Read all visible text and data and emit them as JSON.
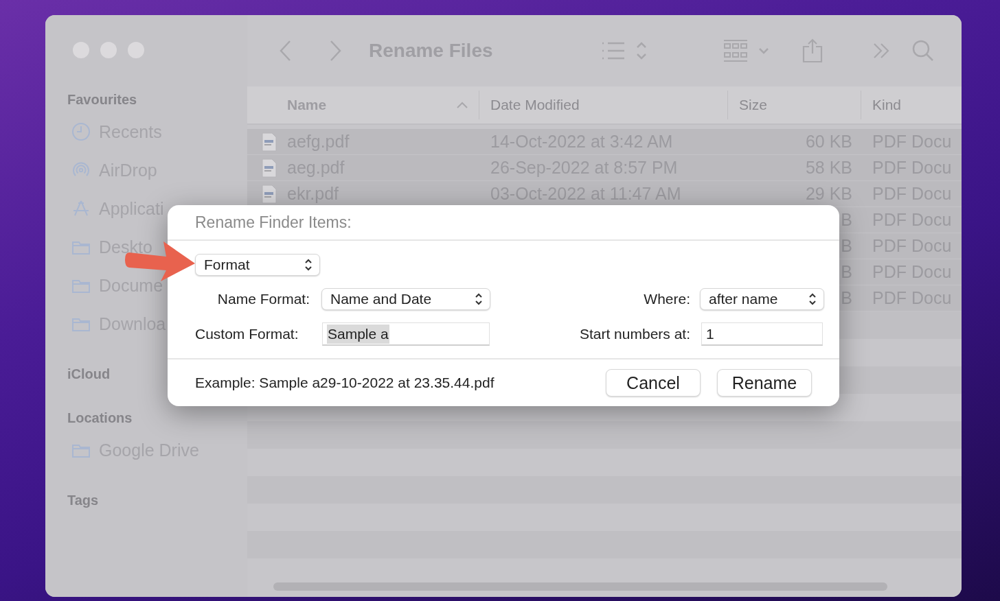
{
  "window": {
    "title": "Rename Files"
  },
  "sidebar": {
    "sections": [
      {
        "heading": "Favourites",
        "items": [
          {
            "label": "Recents",
            "kind": "clock"
          },
          {
            "label": "AirDrop",
            "kind": "airdrop"
          },
          {
            "label": "Applicati",
            "kind": "apps"
          },
          {
            "label": "Deskto",
            "kind": "folder"
          },
          {
            "label": "Docume",
            "kind": "folder"
          },
          {
            "label": "Downloa",
            "kind": "folder"
          }
        ]
      },
      {
        "heading": "iCloud"
      },
      {
        "heading": "Locations",
        "items": [
          {
            "label": "Google Drive",
            "kind": "folder"
          }
        ]
      },
      {
        "heading": "Tags"
      }
    ]
  },
  "table": {
    "columns": [
      {
        "label": "Name",
        "sorted": true
      },
      {
        "label": "Date Modified",
        "sorted": false
      },
      {
        "label": "Size",
        "sorted": false
      },
      {
        "label": "Kind",
        "sorted": false
      }
    ],
    "rows": [
      {
        "name": "aefg.pdf",
        "date": "14-Oct-2022 at 3:42 AM",
        "size": "60 KB",
        "kind": "PDF Docu",
        "selected": true
      },
      {
        "name": "aeg.pdf",
        "date": "26-Sep-2022 at 8:57 PM",
        "size": "58 KB",
        "kind": "PDF Docu",
        "selected": true
      },
      {
        "name": "ekr.pdf",
        "date": "03-Oct-2022 at 11:47 AM",
        "size": "29 KB",
        "kind": "PDF Docu",
        "selected": true
      },
      {
        "size": "B",
        "kind": "PDF Docu",
        "selected": true
      },
      {
        "size": "B",
        "kind": "PDF Docu",
        "selected": true
      },
      {
        "size": "B",
        "kind": "PDF Docu",
        "selected": true
      },
      {
        "size": "B",
        "kind": "PDF Docu",
        "selected": true
      }
    ]
  },
  "dialog": {
    "title": "Rename Finder Items:",
    "mode": "Format",
    "name_format": {
      "label": "Name Format:",
      "value": "Name and Date"
    },
    "where": {
      "label": "Where:",
      "value": "after name"
    },
    "custom_format": {
      "label": "Custom Format:",
      "value": "Sample a",
      "text_selected": true
    },
    "start_numbers": {
      "label": "Start numbers at:",
      "value": "1"
    },
    "example": "Example: Sample a29-10-2022 at 23.35.44.pdf",
    "buttons": [
      "Cancel",
      "Rename"
    ]
  }
}
